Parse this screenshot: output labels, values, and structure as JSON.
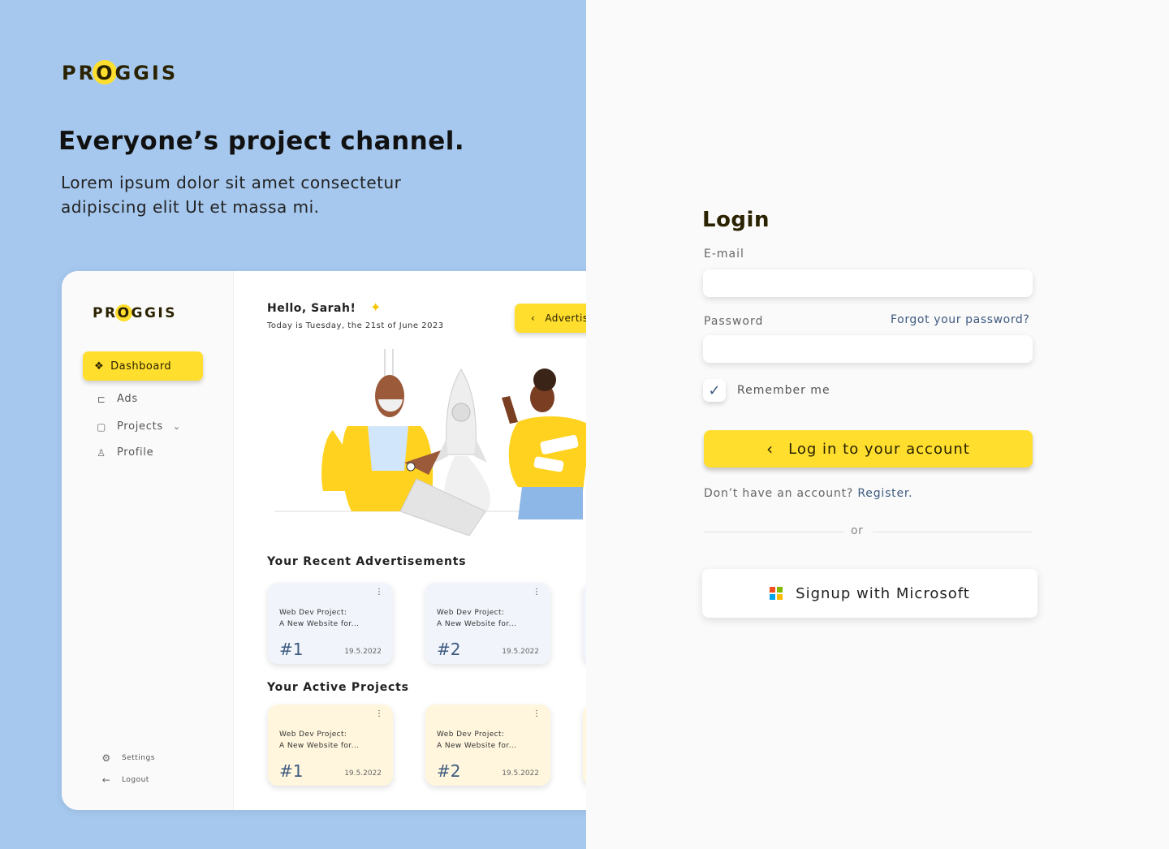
{
  "brand": {
    "logo_pre": "PR",
    "logo_o": "O",
    "logo_post": "GGIS"
  },
  "hero": {
    "headline": "Everyone’s project channel.",
    "subline": "Lorem ipsum dolor sit amet consectetur adipiscing elit Ut et massa mi."
  },
  "mock": {
    "sidebar": {
      "dashboard": "Dashboard",
      "items": [
        {
          "label": "Ads",
          "icon": "megaphone-icon"
        },
        {
          "label": "Projects",
          "icon": "clipboard-icon"
        },
        {
          "label": "Profile",
          "icon": "user-icon"
        }
      ],
      "settings": "Settings",
      "logout": "Logout"
    },
    "greeting": "Hello, Sarah!",
    "date_text": "Today is Tuesday, the 21st of June 2023",
    "adv_button": "Advertise",
    "recent_ads_title": "Your Recent Advertisements",
    "active_projects_title": "Your Active Projects",
    "ads": [
      {
        "line1": "Web Dev Project:",
        "line2": "A New Website for...",
        "num": "#1",
        "date": "19.5.2022"
      },
      {
        "line1": "Web Dev Project:",
        "line2": "A New Website for...",
        "num": "#2",
        "date": "19.5.2022"
      }
    ],
    "projects": [
      {
        "line1": "Web Dev Project:",
        "line2": "A New Website for...",
        "num": "#1",
        "date": "19.5.2022"
      },
      {
        "line1": "Web Dev Project:",
        "line2": "A New Website for...",
        "num": "#2",
        "date": "19.5.2022"
      }
    ]
  },
  "login": {
    "title": "Login",
    "email_label": "E-mail",
    "email_value": "",
    "password_label": "Password",
    "password_value": "",
    "forgot": "Forgot your password?",
    "remember": "Remember me",
    "remember_checked": true,
    "submit": "Log in to your account",
    "no_account": "Don’t have an account?",
    "register": "Register.",
    "or": "or",
    "microsoft": "Signup with Microsoft"
  },
  "colors": {
    "accent": "#ffde2e",
    "panel": "#a6c8ee",
    "link": "#3d5a80"
  }
}
